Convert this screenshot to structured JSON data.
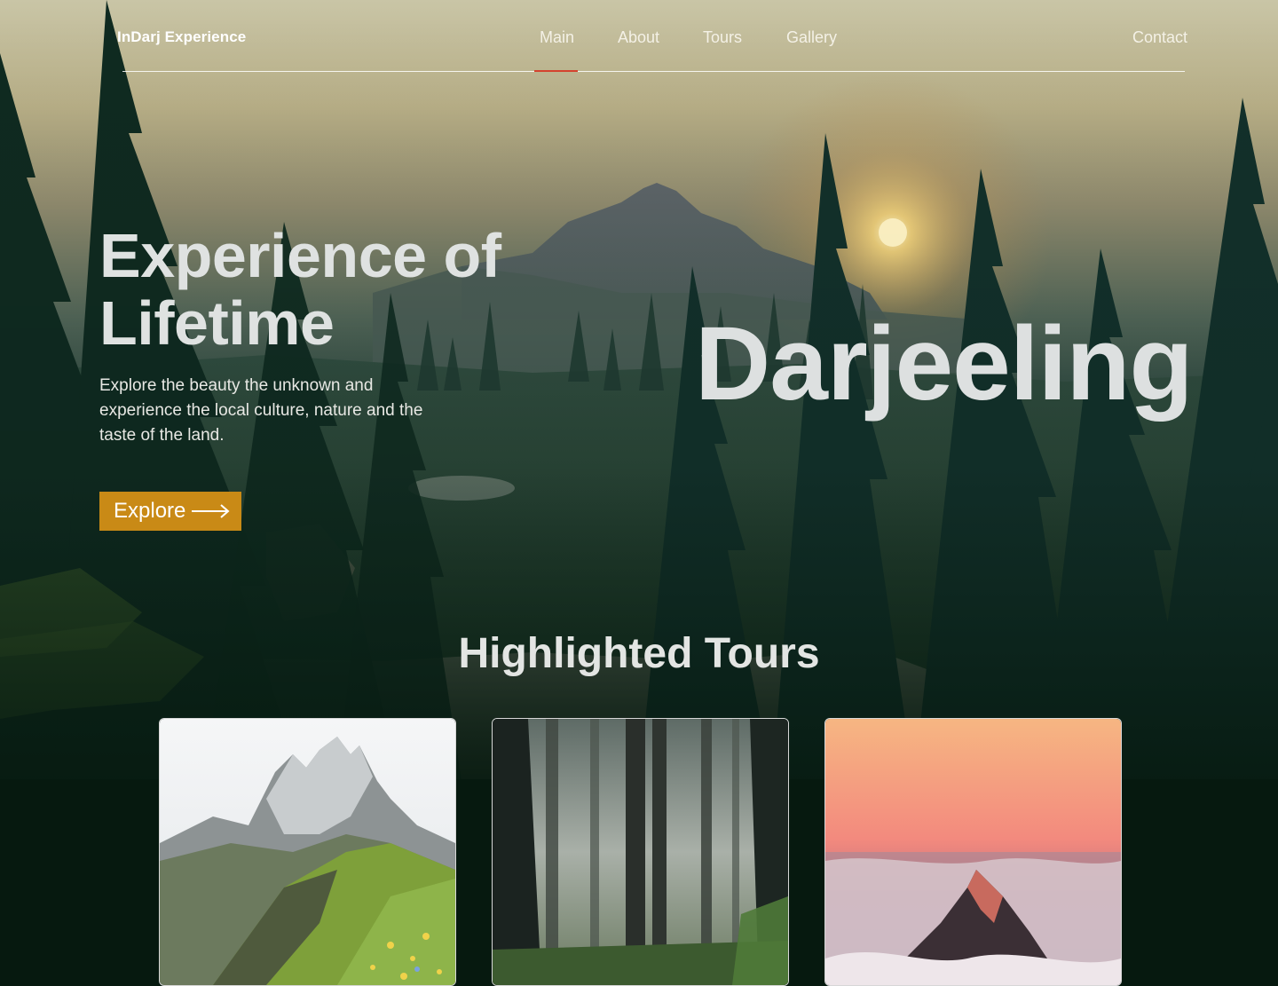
{
  "nav": {
    "brand": "InDarj Experience",
    "links": [
      "Main",
      "About",
      "Tours",
      "Gallery"
    ],
    "active": "Main",
    "contact": "Contact",
    "accent_color": "#d4422e"
  },
  "hero": {
    "title": "Experience of Lifetime",
    "description": "Explore the beauty the unknown and experience the local culture, nature and the taste of the land.",
    "button_label": "Explore",
    "button_icon": "arrow-right-icon",
    "button_color": "#c98a16",
    "place_name": "Darjeeling"
  },
  "tours": {
    "title": "Highlighted Tours",
    "cards": [
      {
        "image": "mountain-meadow-image"
      },
      {
        "image": "misty-forest-image"
      },
      {
        "image": "peak-above-clouds-image"
      }
    ]
  }
}
